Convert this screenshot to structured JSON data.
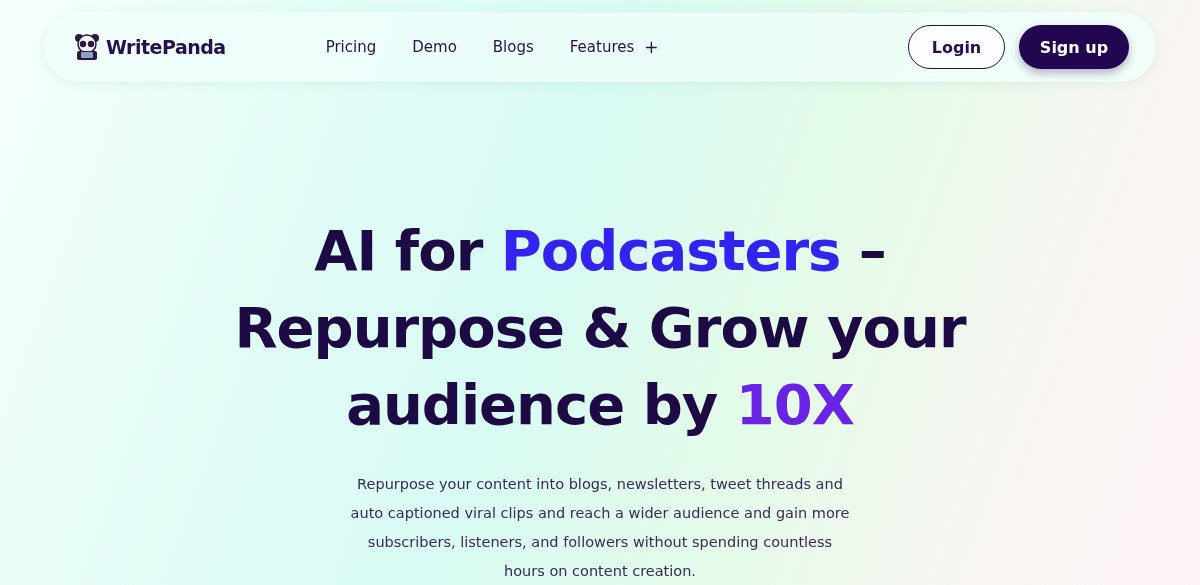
{
  "nav": {
    "brand": "WritePanda",
    "links": [
      {
        "label": "Pricing"
      },
      {
        "label": "Demo"
      },
      {
        "label": "Blogs"
      },
      {
        "label": "Features",
        "expander": "+"
      }
    ],
    "buttons": [
      {
        "label": "Login",
        "kind": "outline"
      },
      {
        "label": "Sign up",
        "kind": "filled"
      }
    ]
  },
  "hero": {
    "headline": [
      {
        "text": "AI for ",
        "kind": "plain"
      },
      {
        "text": "Podcasters",
        "kind": "highlight"
      },
      {
        "text": " – Repurpose & Grow your audience by ",
        "kind": "plain"
      },
      {
        "text": "10X",
        "kind": "emphasis"
      }
    ],
    "description": "Repurpose your content into blogs, newsletters, tweet threads and auto captioned viral clips and reach a wider audience and gain more subscribers, listeners, and followers without spending countless hours on content creation."
  }
}
